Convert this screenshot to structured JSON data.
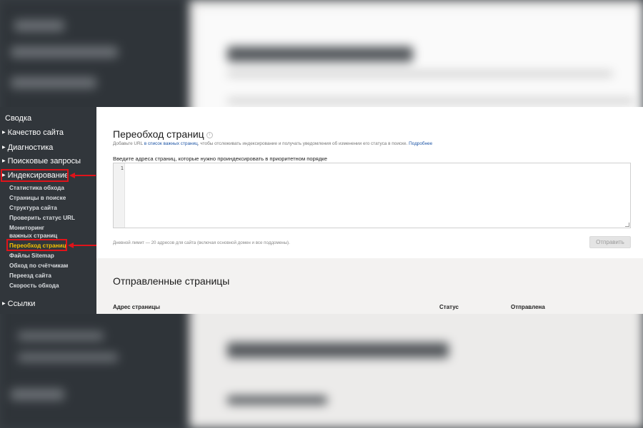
{
  "sidebar": {
    "items": [
      {
        "label": "Сводка",
        "arrow": false
      },
      {
        "label": "Качество сайта",
        "arrow": true
      },
      {
        "label": "Диагностика",
        "arrow": true
      },
      {
        "label": "Поисковые запросы",
        "arrow": true
      },
      {
        "label": "Индексирование",
        "arrow": true,
        "highlighted": true
      },
      {
        "label": "Ссылки",
        "arrow": true
      }
    ],
    "subitems": [
      "Статистика обхода",
      "Страницы в поиске",
      "Структура сайта",
      "Проверить статус URL",
      "Мониторинг",
      "важных страниц",
      "Переобход страниц",
      "Файлы Sitemap",
      "Обход по счётчикам",
      "Переезд сайта",
      "Скорость обхода"
    ],
    "active_subitem": "Переобход страниц"
  },
  "main": {
    "title": "Переобход страниц",
    "info_icon": "i",
    "desc_prefix": "Добавьте URL ",
    "desc_link": "в список важных страниц",
    "desc_middle": ", чтобы отслеживать индексирование и получать уведомления об изменении его статуса в поиске. ",
    "desc_more": "Подробнее",
    "input_label": "Введите адреса страниц, которые нужно проиндексировать в приоритетном порядке",
    "line_number": "1",
    "limit_text": "Дневной лимит — 20 адресов для сайта (включая основной домен и все поддомены).",
    "send_button": "Отправить",
    "sent_title": "Отправленные страницы",
    "columns": [
      "Адрес страницы",
      "Статус",
      "Отправлена"
    ]
  },
  "colors": {
    "sidebar_bg": "#31363b",
    "active": "#f5c200",
    "annotation": "#e0131a",
    "link": "#1f56a6"
  }
}
